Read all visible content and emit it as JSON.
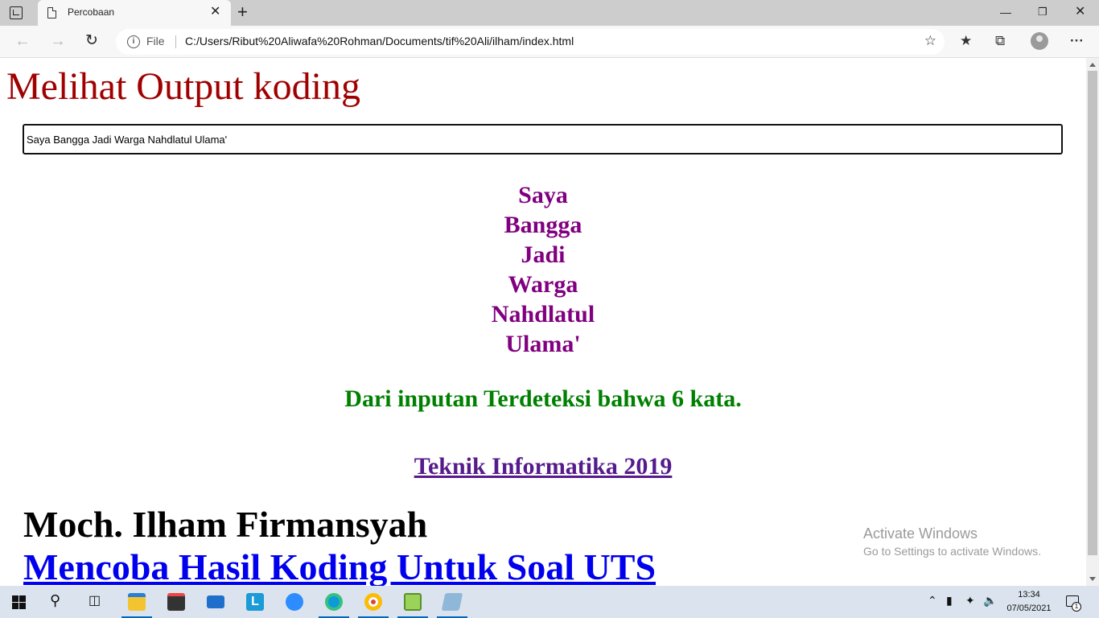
{
  "browser": {
    "tab_title": "Percobaan",
    "tab_close": "✕",
    "new_tab": "+",
    "address_scheme": "File",
    "url": "C:/Users/Ribut%20Aliwafa%20Rohman/Documents/tif%20Ali/ilham/index.html"
  },
  "page": {
    "heading": "Melihat Output koding",
    "input_value": "Saya Bangga Jadi Warga Nahdlatul Ulama'",
    "words": [
      "Saya",
      "Bangga",
      "Jadi",
      "Warga",
      "Nahdlatul",
      "Ulama'"
    ],
    "result_text": "Dari inputan Terdeteksi bahwa 6 kata.",
    "org_link": "Teknik Informatika 2019",
    "author": "Moch. Ilham Firmansyah",
    "uts_link": "Mencoba Hasil Koding Untuk Soal UTS"
  },
  "watermark": {
    "line1": "Activate Windows",
    "line2": "Go to Settings to activate Windows."
  },
  "taskbar": {
    "time": "13:34",
    "date": "07/05/2021",
    "notification_count": "1",
    "apps": [
      "file-explorer",
      "microsoft-store",
      "mail",
      "l-app",
      "zoom",
      "edge",
      "chrome",
      "notepad-plus",
      "generic-app"
    ]
  },
  "colors": {
    "heading": "#a00000",
    "words": "#800080",
    "result": "#008000",
    "visited_link": "#551a8b",
    "link": "#0000ee"
  }
}
